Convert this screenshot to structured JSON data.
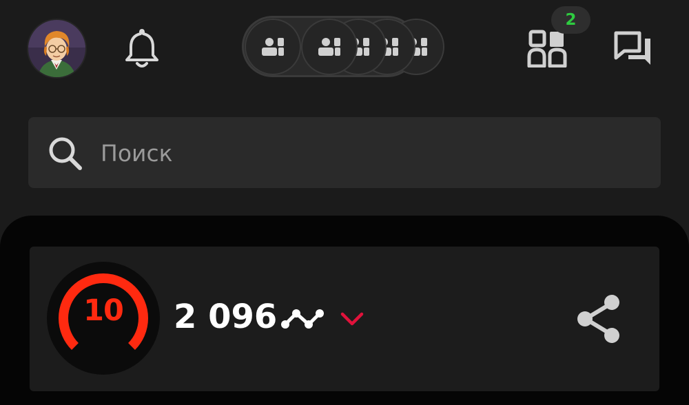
{
  "header": {
    "avatar_icon": "user-avatar",
    "notifications_icon": "bell-icon",
    "group_icon": "group-icon",
    "friends_icon": "friends-icon",
    "friends_badge": "2",
    "chat_icon": "chat-icon"
  },
  "search": {
    "placeholder": "Поиск",
    "value": ""
  },
  "rating_card": {
    "level": "10",
    "level_fraction": 0.75,
    "score": "2 096",
    "trend_icon": "trend-icon",
    "dropdown_icon": "chevron-down-icon",
    "share_icon": "share-icon"
  },
  "colors": {
    "background": "#1b1b1b",
    "panel": "#050505",
    "card": "#1c1c1c",
    "level_accent": "#ff2a10",
    "chevron": "#e0123b",
    "badge_text": "#2ecc40"
  }
}
